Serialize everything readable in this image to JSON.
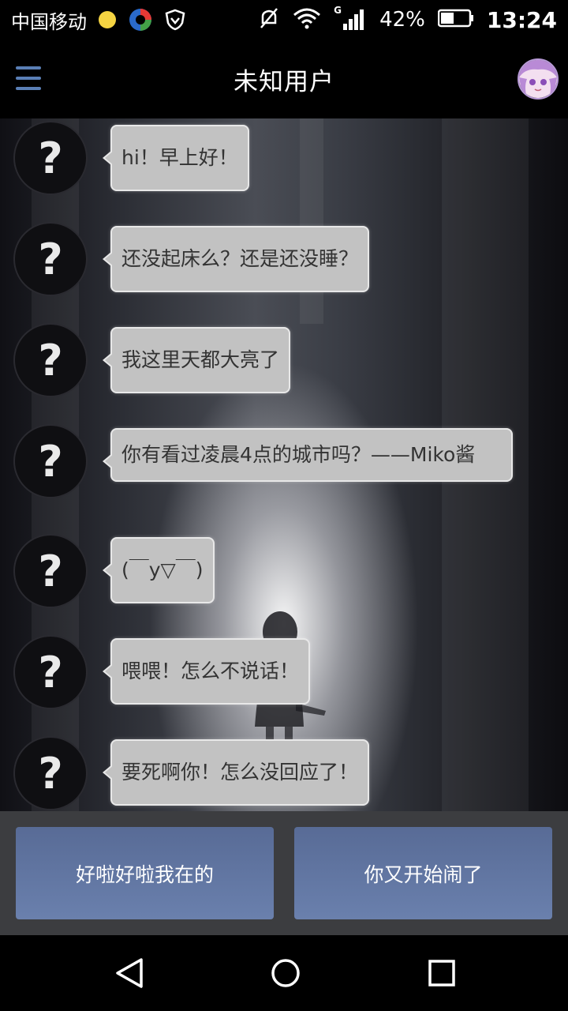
{
  "status_bar": {
    "carrier": "中国移动",
    "network_type": "G",
    "battery_percent": "42%",
    "time": "13:24",
    "icons": [
      "notification-dot-icon",
      "app-icon",
      "shield-icon",
      "mute-icon",
      "wifi-icon",
      "signal-icon",
      "battery-icon"
    ]
  },
  "app_bar": {
    "title": "未知用户",
    "menu_icon": "hamburger-menu-icon",
    "avatar": "user-avatar"
  },
  "messages": [
    {
      "sender_icon": "question-avatar-icon",
      "avatar_glyph": "?",
      "text": "hi！早上好！"
    },
    {
      "sender_icon": "question-avatar-icon",
      "avatar_glyph": "?",
      "text": "还没起床么？还是还没睡？"
    },
    {
      "sender_icon": "question-avatar-icon",
      "avatar_glyph": "?",
      "text": "我这里天都大亮了"
    },
    {
      "sender_icon": "question-avatar-icon",
      "avatar_glyph": "?",
      "text": "你有看过凌晨4点的城市吗？——Miko酱"
    },
    {
      "sender_icon": "question-avatar-icon",
      "avatar_glyph": "?",
      "text": "(￣y▽￣)"
    },
    {
      "sender_icon": "question-avatar-icon",
      "avatar_glyph": "?",
      "text": "喂喂！怎么不说话！"
    },
    {
      "sender_icon": "question-avatar-icon",
      "avatar_glyph": "?",
      "text": "要死啊你！怎么没回应了！"
    }
  ],
  "replies": {
    "option_1": "好啦好啦我在的",
    "option_2": "你又开始闹了"
  },
  "nav_bar": {
    "icons": [
      "back-icon",
      "home-icon",
      "recents-icon"
    ]
  },
  "colors": {
    "accent": "#5a7fb6",
    "bubble": "#c2c2c2",
    "reply_button": "#5f739f"
  }
}
